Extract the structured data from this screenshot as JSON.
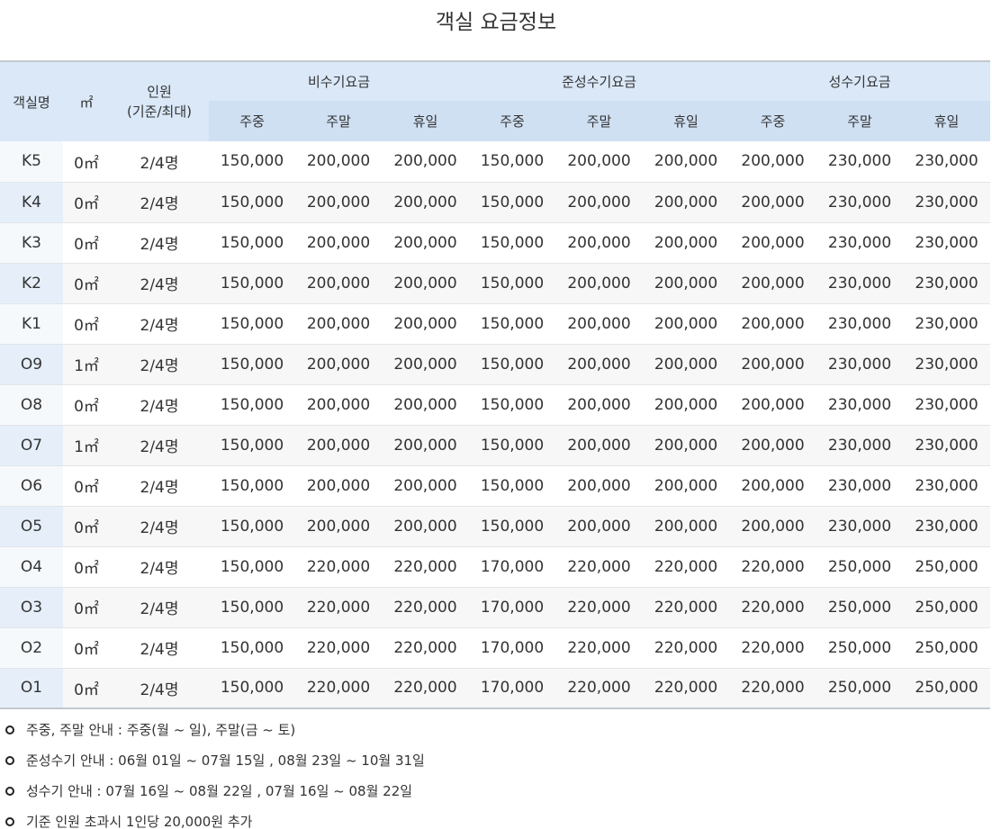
{
  "title": "객실 요금정보",
  "header": {
    "room_name": "객실명",
    "area": "㎡",
    "occupancy": "인원",
    "occupancy_sub": "(기준/최대)",
    "seasons": [
      "비수기요금",
      "준성수기요금",
      "성수기요금"
    ],
    "day_types": [
      "주중",
      "주말",
      "휴일"
    ]
  },
  "rows": [
    {
      "room": "K5",
      "area": "0㎡",
      "occupancy": "2/4명",
      "rates": [
        "150,000",
        "200,000",
        "200,000",
        "150,000",
        "200,000",
        "200,000",
        "200,000",
        "230,000",
        "230,000"
      ]
    },
    {
      "room": "K4",
      "area": "0㎡",
      "occupancy": "2/4명",
      "rates": [
        "150,000",
        "200,000",
        "200,000",
        "150,000",
        "200,000",
        "200,000",
        "200,000",
        "230,000",
        "230,000"
      ]
    },
    {
      "room": "K3",
      "area": "0㎡",
      "occupancy": "2/4명",
      "rates": [
        "150,000",
        "200,000",
        "200,000",
        "150,000",
        "200,000",
        "200,000",
        "200,000",
        "230,000",
        "230,000"
      ]
    },
    {
      "room": "K2",
      "area": "0㎡",
      "occupancy": "2/4명",
      "rates": [
        "150,000",
        "200,000",
        "200,000",
        "150,000",
        "200,000",
        "200,000",
        "200,000",
        "230,000",
        "230,000"
      ]
    },
    {
      "room": "K1",
      "area": "0㎡",
      "occupancy": "2/4명",
      "rates": [
        "150,000",
        "200,000",
        "200,000",
        "150,000",
        "200,000",
        "200,000",
        "200,000",
        "230,000",
        "230,000"
      ]
    },
    {
      "room": "O9",
      "area": "1㎡",
      "occupancy": "2/4명",
      "rates": [
        "150,000",
        "200,000",
        "200,000",
        "150,000",
        "200,000",
        "200,000",
        "200,000",
        "230,000",
        "230,000"
      ]
    },
    {
      "room": "O8",
      "area": "0㎡",
      "occupancy": "2/4명",
      "rates": [
        "150,000",
        "200,000",
        "200,000",
        "150,000",
        "200,000",
        "200,000",
        "200,000",
        "230,000",
        "230,000"
      ]
    },
    {
      "room": "O7",
      "area": "1㎡",
      "occupancy": "2/4명",
      "rates": [
        "150,000",
        "200,000",
        "200,000",
        "150,000",
        "200,000",
        "200,000",
        "200,000",
        "230,000",
        "230,000"
      ]
    },
    {
      "room": "O6",
      "area": "0㎡",
      "occupancy": "2/4명",
      "rates": [
        "150,000",
        "200,000",
        "200,000",
        "150,000",
        "200,000",
        "200,000",
        "200,000",
        "230,000",
        "230,000"
      ]
    },
    {
      "room": "O5",
      "area": "0㎡",
      "occupancy": "2/4명",
      "rates": [
        "150,000",
        "200,000",
        "200,000",
        "150,000",
        "200,000",
        "200,000",
        "200,000",
        "230,000",
        "230,000"
      ]
    },
    {
      "room": "O4",
      "area": "0㎡",
      "occupancy": "2/4명",
      "rates": [
        "150,000",
        "220,000",
        "220,000",
        "170,000",
        "220,000",
        "220,000",
        "220,000",
        "250,000",
        "250,000"
      ]
    },
    {
      "room": "O3",
      "area": "0㎡",
      "occupancy": "2/4명",
      "rates": [
        "150,000",
        "220,000",
        "220,000",
        "170,000",
        "220,000",
        "220,000",
        "220,000",
        "250,000",
        "250,000"
      ]
    },
    {
      "room": "O2",
      "area": "0㎡",
      "occupancy": "2/4명",
      "rates": [
        "150,000",
        "220,000",
        "220,000",
        "170,000",
        "220,000",
        "220,000",
        "220,000",
        "250,000",
        "250,000"
      ]
    },
    {
      "room": "O1",
      "area": "0㎡",
      "occupancy": "2/4명",
      "rates": [
        "150,000",
        "220,000",
        "220,000",
        "170,000",
        "220,000",
        "220,000",
        "220,000",
        "250,000",
        "250,000"
      ]
    }
  ],
  "notes": [
    "주중, 주말 안내 : 주중(월 ~ 일), 주말(금 ~ 토)",
    "준성수기 안내 : 06월 01일 ~ 07월 15일 , 08월 23일 ~ 10월 31일",
    "성수기 안내 : 07월 16일 ~ 08월 22일 , 07월 16일 ~ 08월 22일",
    "기준 인원 초과시 1인당 20,000원 추가"
  ]
}
